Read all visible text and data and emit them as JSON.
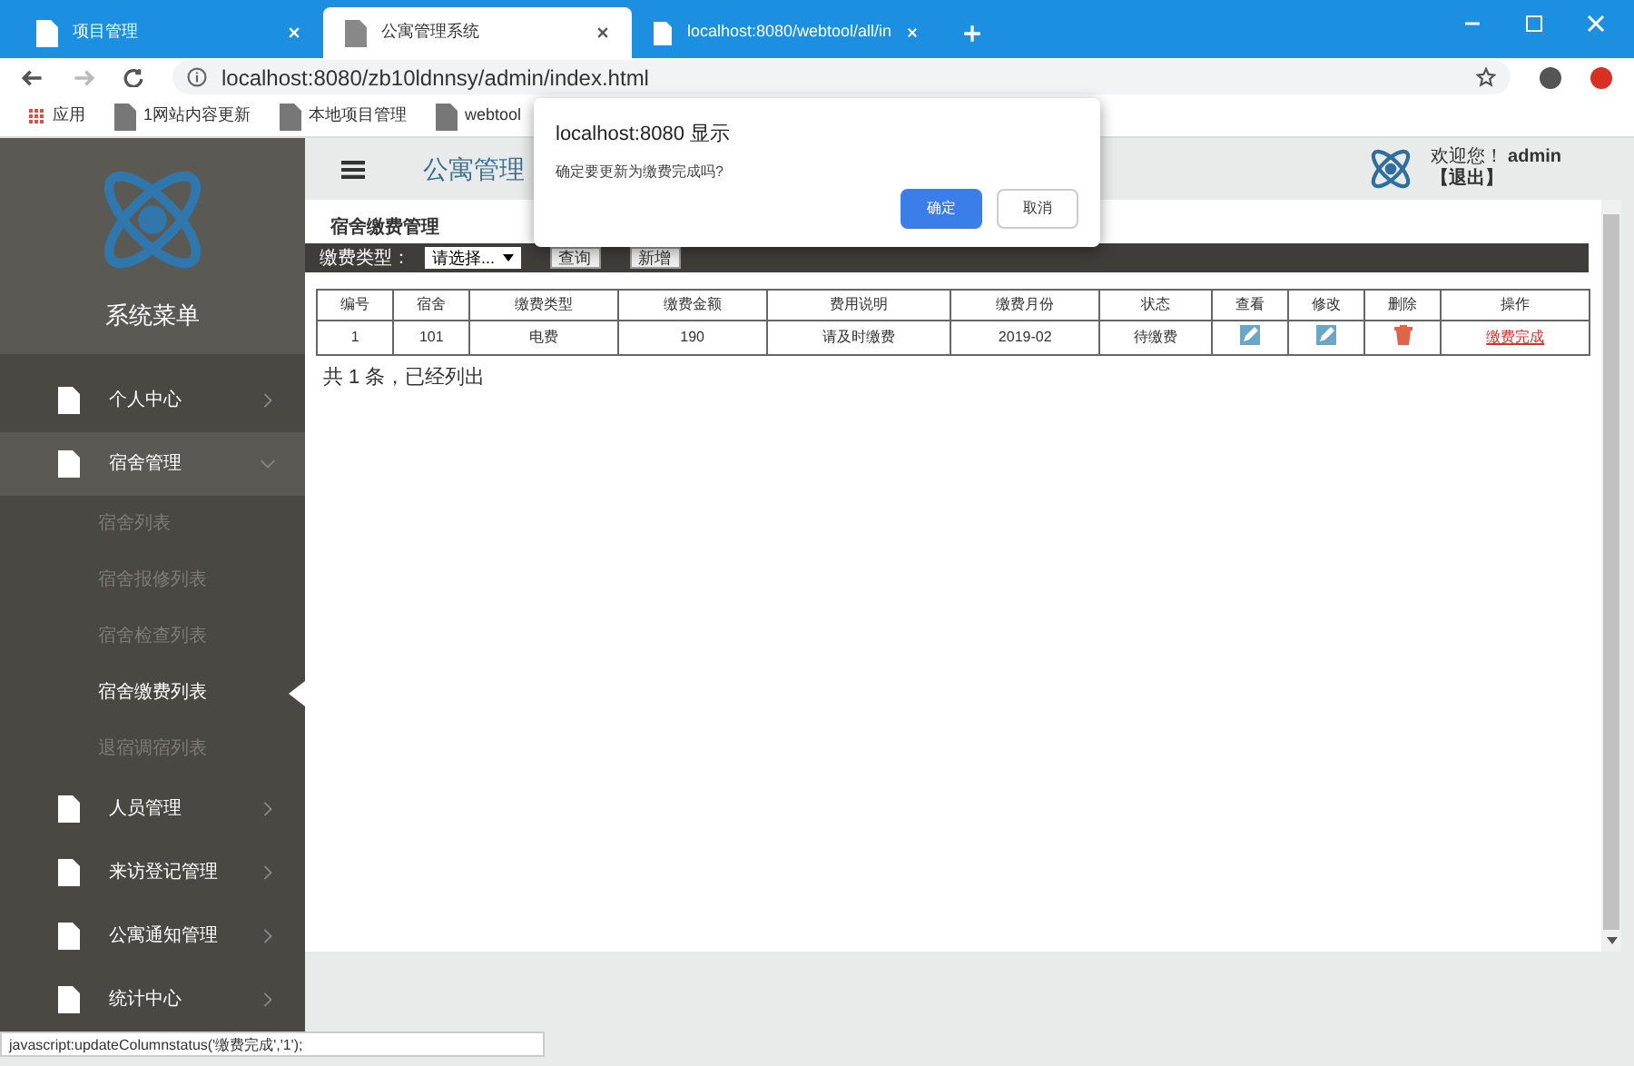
{
  "browser": {
    "tabs": [
      {
        "label": "项目管理",
        "selected": false
      },
      {
        "label": "公寓管理系统",
        "selected": true
      },
      {
        "label": "localhost:8080/webtool/all/in",
        "selected": false
      }
    ],
    "address": "localhost:8080/zb10ldnnsy/admin/index.html",
    "bookmarks": [
      "应用",
      "1网站内容更新",
      "本地项目管理",
      "webtool"
    ]
  },
  "dialog": {
    "title": "localhost:8080 显示",
    "message": "确定要更新为缴费完成吗?",
    "buttons": [
      {
        "label": "确定",
        "kind": "primary"
      },
      {
        "label": "取消",
        "kind": "secondary"
      }
    ]
  },
  "header": {
    "title": "公寓管理",
    "welcome": "欢迎您！",
    "user": "admin",
    "logout": "【退出】"
  },
  "sidebar": {
    "title": "系统菜单",
    "items": [
      {
        "label": "个人中心",
        "expanded": false,
        "selected": false
      },
      {
        "label": "宿舍管理",
        "expanded": true,
        "selected": true,
        "children": [
          {
            "label": "宿舍列表",
            "selected": false
          },
          {
            "label": "宿舍报修列表",
            "selected": false
          },
          {
            "label": "宿舍检查列表",
            "selected": false
          },
          {
            "label": "宿舍缴费列表",
            "selected": true
          },
          {
            "label": "退宿调宿列表",
            "selected": false
          }
        ]
      },
      {
        "label": "人员管理",
        "expanded": false,
        "selected": false
      },
      {
        "label": "来访登记管理",
        "expanded": false,
        "selected": false
      },
      {
        "label": "公寓通知管理",
        "expanded": false,
        "selected": false
      },
      {
        "label": "统计中心",
        "expanded": false,
        "selected": false
      }
    ]
  },
  "content": {
    "breadcrumb": "宿舍缴费管理",
    "filter": {
      "label": "缴费类型：",
      "select": "请选择...",
      "buttons": [
        "查询",
        "新增"
      ]
    },
    "table": {
      "columns": [
        "编号",
        "宿舍",
        "缴费类型",
        "缴费金额",
        "费用说明",
        "缴费月份",
        "状态",
        "查看",
        "修改",
        "删除",
        "操作"
      ],
      "rows": [
        {
          "cells": [
            "1",
            "101",
            "电费",
            "190",
            "请及时缴费",
            "2019-02",
            "待缴费"
          ],
          "action": "缴费完成"
        }
      ]
    },
    "count": "共 1 条，已经列出"
  },
  "status_link": "javascript:updateColumnstatus('缴费完成','1');"
}
